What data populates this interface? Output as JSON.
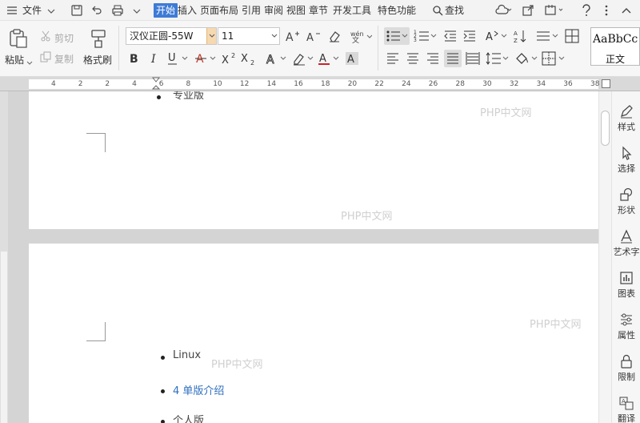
{
  "menu": {
    "file": "文件",
    "tabs": [
      "开始",
      "插入",
      "页面布局",
      "引用",
      "审阅",
      "视图",
      "章节",
      "开发工具",
      "特色功能"
    ],
    "active_tab": "开始",
    "search": "查找"
  },
  "ribbon": {
    "paste": "粘贴",
    "cut": "剪切",
    "copy": "复制",
    "format_painter": "格式刷",
    "font_name": "汉仪正圆-55W",
    "font_size": "11",
    "style_preview": "AaBbCc",
    "style_name": "正文"
  },
  "ruler": {
    "numbers": [
      "4",
      "2",
      "2",
      "4",
      "6",
      "8",
      "10",
      "12",
      "14",
      "16",
      "18",
      "20",
      "22",
      "24",
      "26",
      "28",
      "30",
      "32",
      "34",
      "36",
      "38"
    ]
  },
  "document": {
    "page1": {
      "item_partial": "专业版"
    },
    "page2": {
      "item1": "Linux",
      "item2": "4 单版介绍",
      "item3_partial": "个人版"
    }
  },
  "watermark": "PHP中文网",
  "right_panel": {
    "items": [
      "样式",
      "选择",
      "形状",
      "艺术字",
      "图表",
      "属性",
      "限制",
      "翻译"
    ]
  },
  "colors": {
    "accent": "#3d7bd6",
    "link_text": "#2f6fbf",
    "canvas_bg": "#d4d4d4"
  }
}
